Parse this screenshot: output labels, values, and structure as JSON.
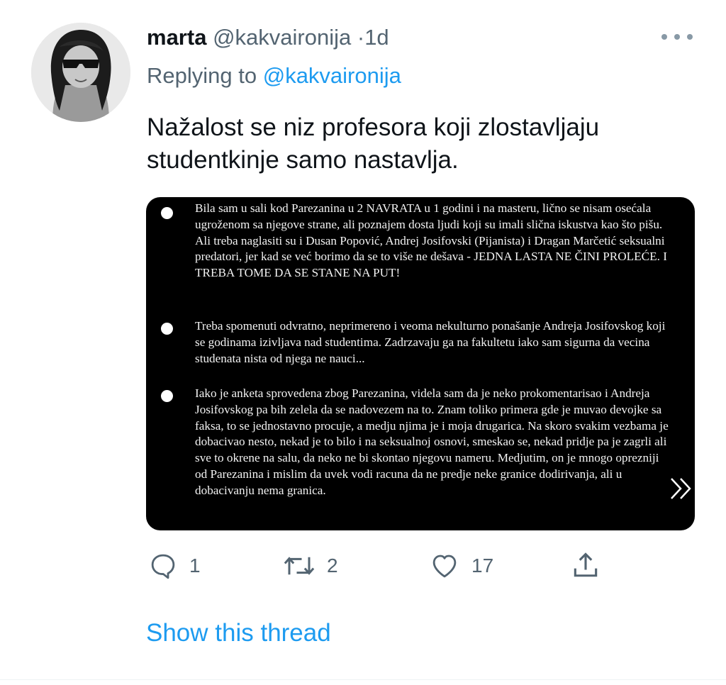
{
  "tweet": {
    "display_name": "marta",
    "handle": "@kakvaironija",
    "separator": "·",
    "timestamp": "1d",
    "replying_prefix": "Replying to",
    "replying_handle": "@kakvaironija",
    "text": "Nažalost se niz profesora koji zlostavljaju studentkinje samo nastavlja."
  },
  "media": {
    "paragraphs": [
      "Bila sam u sali kod Parezanina u 2 NAVRATA u 1 godini i na masteru, lično se nisam osećala ugroženom sa njegove strane, ali poznajem dosta ljudi koji su imali slična iskustva kao što pišu. Ali treba naglasiti su i Dusan Popović, Andrej Josifovski (Pijanista) i Dragan Marčetić seksualni predatori, jer kad se već borimo da se to više ne dešava - JEDNA LASTA NE ČINI PROLEĆE. I TREBA TOME DA SE STANE NA PUT!",
      "Treba spomenuti odvratno, neprimereno i veoma nekulturno ponašanje Andreja Josifovskog koji se godinama izivljava nad studentima. Zadrzavaju ga na fakultetu iako sam sigurna da vecina studenata nista od njega ne nauci...",
      "Iako je anketa sprovedena zbog Parezanina, videla sam da je neko prokomentarisao i Andreja Josifovskog pa bih zelela da se nadovezem na to. Znam toliko primera gde je muvao devojke sa faksa, to se jednostavno procuje, a medju njima je i moja drugarica. Na skoro svakim vezbama je dobacivao nesto, nekad je to bilo i na seksualnoj osnovi, smeskao se, nekad pridje pa je zagrli ali sve to okrene na salu, da neko ne bi skontao njegovu nameru. Medjutim, on je mnogo oprezniji od Parezanina i mislim da uvek vodi racuna da ne predje neke granice dodirivanja, ali u dobacivanju nema granica."
    ]
  },
  "actions": {
    "reply_count": "1",
    "retweet_count": "2",
    "like_count": "17"
  },
  "show_thread_label": "Show this thread",
  "icons": {
    "more": "more-horizontal-icon",
    "reply": "reply-icon",
    "retweet": "retweet-icon",
    "like": "heart-icon",
    "share": "share-icon",
    "next": "chevron-double-right-icon"
  },
  "colors": {
    "link": "#1d9bf0",
    "secondary_text": "#536471",
    "primary_text": "#0f1419",
    "media_background": "#000000"
  }
}
